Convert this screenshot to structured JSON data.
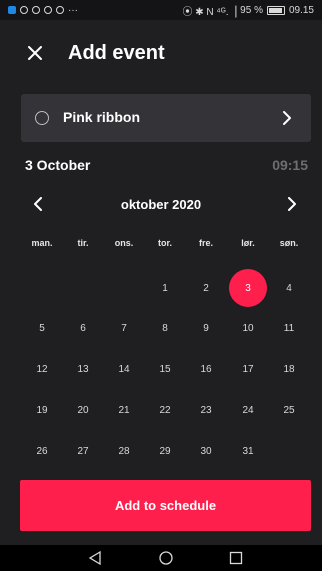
{
  "status_bar": {
    "left_icons": [
      "app-badge-icon",
      "hotspot-icon",
      "messenger-icon",
      "chat-icon",
      "chat-icon",
      "more-dots-icon"
    ],
    "right_text": "95 %",
    "time": "09.15",
    "more": "···",
    "signal": "⦿ ✱ N ⁴ᴳ.▕"
  },
  "header": {
    "title": "Add event"
  },
  "event": {
    "name": "Pink ribbon"
  },
  "date": {
    "label": "3 October",
    "time": "09:15"
  },
  "calendar": {
    "month": "oktober 2020",
    "weekdays": [
      "man.",
      "tir.",
      "ons.",
      "tor.",
      "fre.",
      "lør.",
      "søn."
    ],
    "days": [
      [
        "",
        "",
        "",
        "1",
        "2",
        "3",
        "4"
      ],
      [
        "5",
        "6",
        "7",
        "8",
        "9",
        "10",
        "11"
      ],
      [
        "12",
        "13",
        "14",
        "15",
        "16",
        "17",
        "18"
      ],
      [
        "19",
        "20",
        "21",
        "22",
        "23",
        "24",
        "25"
      ],
      [
        "26",
        "27",
        "28",
        "29",
        "30",
        "31",
        ""
      ]
    ],
    "selected": "3"
  },
  "actions": {
    "primary": "Add to schedule"
  },
  "colors": {
    "accent": "#ff1f4c",
    "background": "#1f1f22",
    "card": "#333338"
  }
}
